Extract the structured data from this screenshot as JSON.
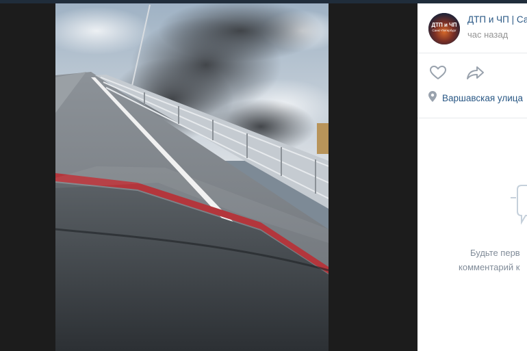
{
  "post": {
    "group_name": "ДТП и ЧП | Са",
    "time": "час назад",
    "location": "Варшавская улица"
  },
  "avatar": {
    "line1": "ДТП и ЧП",
    "line2": "Санкт-Петербург"
  },
  "comments": {
    "empty_line1": "Будьте перв",
    "empty_line2": "комментарий к"
  },
  "icons": {
    "like": "heart-icon",
    "share": "share-icon",
    "location": "location-pin-icon",
    "comments_empty": "comment-bubble-icon"
  },
  "colors": {
    "link": "#2a5885",
    "muted": "#939393",
    "icon": "#99a2ad"
  }
}
